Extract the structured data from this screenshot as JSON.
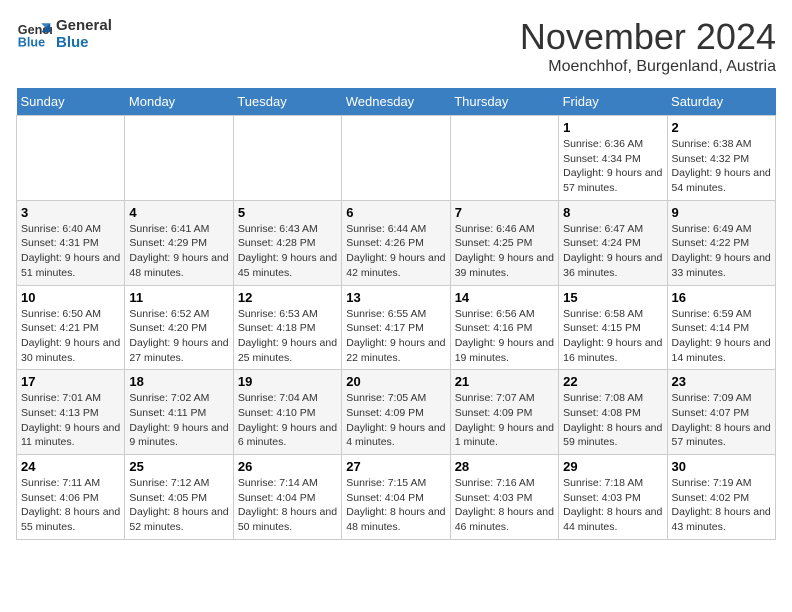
{
  "logo": {
    "line1": "General",
    "line2": "Blue"
  },
  "title": "November 2024",
  "location": "Moenchhof, Burgenland, Austria",
  "days_of_week": [
    "Sunday",
    "Monday",
    "Tuesday",
    "Wednesday",
    "Thursday",
    "Friday",
    "Saturday"
  ],
  "weeks": [
    [
      {
        "day": "",
        "info": ""
      },
      {
        "day": "",
        "info": ""
      },
      {
        "day": "",
        "info": ""
      },
      {
        "day": "",
        "info": ""
      },
      {
        "day": "",
        "info": ""
      },
      {
        "day": "1",
        "info": "Sunrise: 6:36 AM\nSunset: 4:34 PM\nDaylight: 9 hours and 57 minutes."
      },
      {
        "day": "2",
        "info": "Sunrise: 6:38 AM\nSunset: 4:32 PM\nDaylight: 9 hours and 54 minutes."
      }
    ],
    [
      {
        "day": "3",
        "info": "Sunrise: 6:40 AM\nSunset: 4:31 PM\nDaylight: 9 hours and 51 minutes."
      },
      {
        "day": "4",
        "info": "Sunrise: 6:41 AM\nSunset: 4:29 PM\nDaylight: 9 hours and 48 minutes."
      },
      {
        "day": "5",
        "info": "Sunrise: 6:43 AM\nSunset: 4:28 PM\nDaylight: 9 hours and 45 minutes."
      },
      {
        "day": "6",
        "info": "Sunrise: 6:44 AM\nSunset: 4:26 PM\nDaylight: 9 hours and 42 minutes."
      },
      {
        "day": "7",
        "info": "Sunrise: 6:46 AM\nSunset: 4:25 PM\nDaylight: 9 hours and 39 minutes."
      },
      {
        "day": "8",
        "info": "Sunrise: 6:47 AM\nSunset: 4:24 PM\nDaylight: 9 hours and 36 minutes."
      },
      {
        "day": "9",
        "info": "Sunrise: 6:49 AM\nSunset: 4:22 PM\nDaylight: 9 hours and 33 minutes."
      }
    ],
    [
      {
        "day": "10",
        "info": "Sunrise: 6:50 AM\nSunset: 4:21 PM\nDaylight: 9 hours and 30 minutes."
      },
      {
        "day": "11",
        "info": "Sunrise: 6:52 AM\nSunset: 4:20 PM\nDaylight: 9 hours and 27 minutes."
      },
      {
        "day": "12",
        "info": "Sunrise: 6:53 AM\nSunset: 4:18 PM\nDaylight: 9 hours and 25 minutes."
      },
      {
        "day": "13",
        "info": "Sunrise: 6:55 AM\nSunset: 4:17 PM\nDaylight: 9 hours and 22 minutes."
      },
      {
        "day": "14",
        "info": "Sunrise: 6:56 AM\nSunset: 4:16 PM\nDaylight: 9 hours and 19 minutes."
      },
      {
        "day": "15",
        "info": "Sunrise: 6:58 AM\nSunset: 4:15 PM\nDaylight: 9 hours and 16 minutes."
      },
      {
        "day": "16",
        "info": "Sunrise: 6:59 AM\nSunset: 4:14 PM\nDaylight: 9 hours and 14 minutes."
      }
    ],
    [
      {
        "day": "17",
        "info": "Sunrise: 7:01 AM\nSunset: 4:13 PM\nDaylight: 9 hours and 11 minutes."
      },
      {
        "day": "18",
        "info": "Sunrise: 7:02 AM\nSunset: 4:11 PM\nDaylight: 9 hours and 9 minutes."
      },
      {
        "day": "19",
        "info": "Sunrise: 7:04 AM\nSunset: 4:10 PM\nDaylight: 9 hours and 6 minutes."
      },
      {
        "day": "20",
        "info": "Sunrise: 7:05 AM\nSunset: 4:09 PM\nDaylight: 9 hours and 4 minutes."
      },
      {
        "day": "21",
        "info": "Sunrise: 7:07 AM\nSunset: 4:09 PM\nDaylight: 9 hours and 1 minute."
      },
      {
        "day": "22",
        "info": "Sunrise: 7:08 AM\nSunset: 4:08 PM\nDaylight: 8 hours and 59 minutes."
      },
      {
        "day": "23",
        "info": "Sunrise: 7:09 AM\nSunset: 4:07 PM\nDaylight: 8 hours and 57 minutes."
      }
    ],
    [
      {
        "day": "24",
        "info": "Sunrise: 7:11 AM\nSunset: 4:06 PM\nDaylight: 8 hours and 55 minutes."
      },
      {
        "day": "25",
        "info": "Sunrise: 7:12 AM\nSunset: 4:05 PM\nDaylight: 8 hours and 52 minutes."
      },
      {
        "day": "26",
        "info": "Sunrise: 7:14 AM\nSunset: 4:04 PM\nDaylight: 8 hours and 50 minutes."
      },
      {
        "day": "27",
        "info": "Sunrise: 7:15 AM\nSunset: 4:04 PM\nDaylight: 8 hours and 48 minutes."
      },
      {
        "day": "28",
        "info": "Sunrise: 7:16 AM\nSunset: 4:03 PM\nDaylight: 8 hours and 46 minutes."
      },
      {
        "day": "29",
        "info": "Sunrise: 7:18 AM\nSunset: 4:03 PM\nDaylight: 8 hours and 44 minutes."
      },
      {
        "day": "30",
        "info": "Sunrise: 7:19 AM\nSunset: 4:02 PM\nDaylight: 8 hours and 43 minutes."
      }
    ]
  ]
}
